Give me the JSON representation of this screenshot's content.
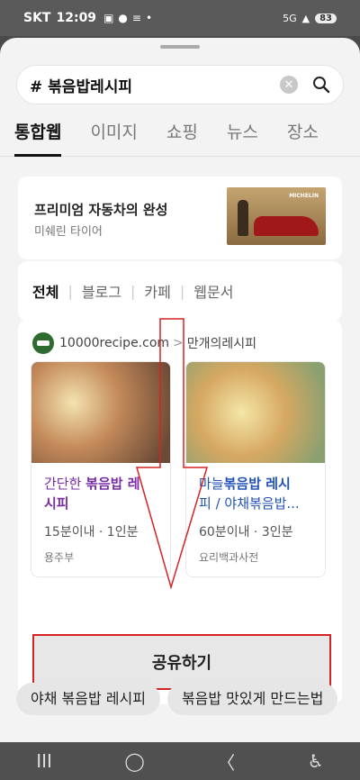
{
  "status": {
    "carrier": "SKT",
    "time": "12:09",
    "battery": "83",
    "network": "5G"
  },
  "search": {
    "query": "# 볶음밥레시피",
    "clear_icon": "✕"
  },
  "tabs": [
    "통합웹",
    "이미지",
    "쇼핑",
    "뉴스",
    "장소"
  ],
  "ad": {
    "title": "프리미엄 자동차의 완성",
    "subtitle": "미쉐린 타이어",
    "image_brand": "MICHELIN"
  },
  "filters": [
    "전체",
    "블로그",
    "카페",
    "웹문서"
  ],
  "source": {
    "site": "10000recipe.com",
    "sep": ">",
    "section": "만개의레시피"
  },
  "recipes": [
    {
      "title_pre": "간단한 ",
      "title_hl": "볶음밥 레",
      "title_post": "시피",
      "meta": "15분이내 · 1인분",
      "source": "용주부"
    },
    {
      "title_pre": "마늘",
      "title_hl": "볶음밥 레시",
      "title_post": "피 / 야채볶음밥...",
      "meta": "60분이내 · 3인분",
      "source": "요리백과사전"
    }
  ],
  "share_label": "공유하기",
  "chips": [
    "야채 볶음밥 레시피",
    "볶음밥 맛있게 만드는법"
  ],
  "nav": {
    "recent": "III",
    "home": "◯",
    "back": "〈",
    "accessibility": "♿"
  },
  "colors": {
    "annotation": "#d62323",
    "highlight_purple": "#7a2ca5",
    "highlight_blue": "#2352b8"
  }
}
